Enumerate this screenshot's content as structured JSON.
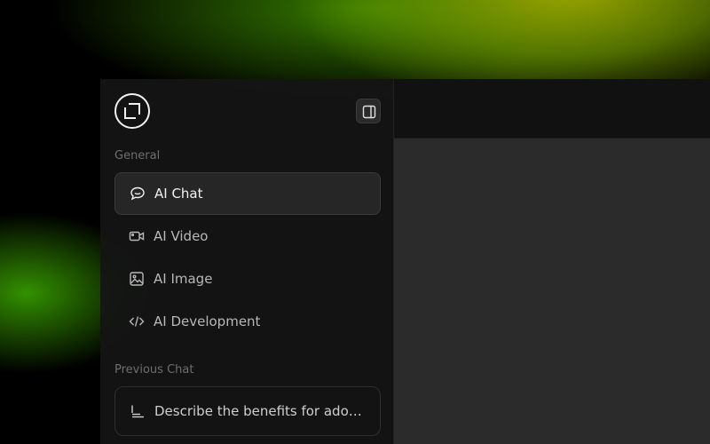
{
  "colors": {
    "sidebar_bg": "#141414",
    "active_bg": "#262626",
    "content_bg": "#2b2b2b",
    "topbar_bg": "#111111",
    "label_gray": "#6e6e6e"
  },
  "sidebar": {
    "logo_icon": "square-bracket-logo-icon",
    "toggle_icon": "sidebar-panel-icon",
    "sections": {
      "general_label": "General",
      "previous_label": "Previous Chat"
    },
    "items": [
      {
        "label": "AI Chat",
        "icon": "chat-bubble-icon",
        "active": true
      },
      {
        "label": "AI Video",
        "icon": "video-camera-icon",
        "active": false
      },
      {
        "label": "AI Image",
        "icon": "image-icon",
        "active": false
      },
      {
        "label": "AI Development",
        "icon": "code-icon",
        "active": false
      }
    ],
    "previous_chats": [
      {
        "label": "Describe the benefits for adop...",
        "icon": "text-lines-icon"
      }
    ]
  }
}
